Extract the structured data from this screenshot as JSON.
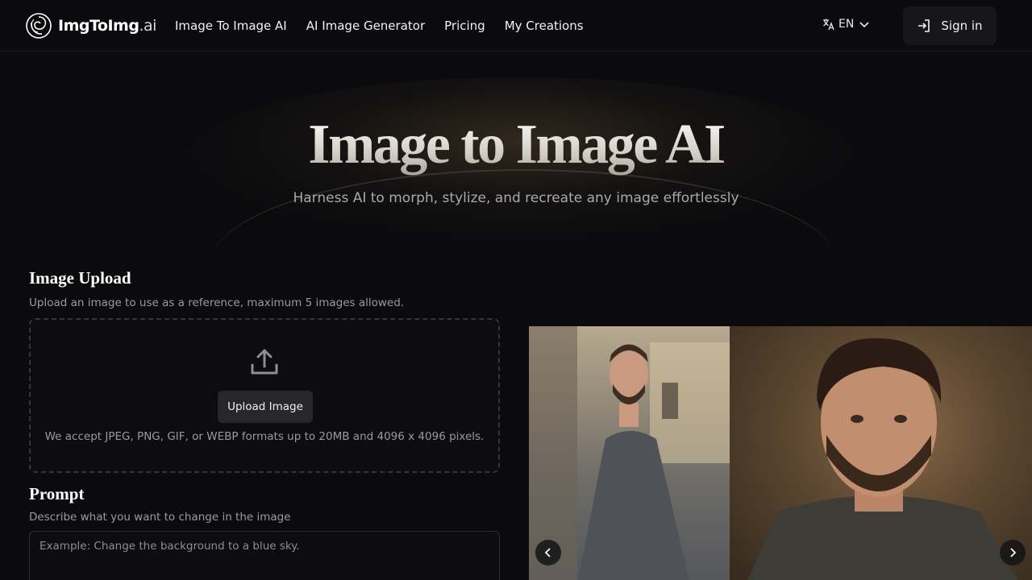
{
  "header": {
    "logo_text": "ImgToImg",
    "logo_suffix": ".ai",
    "nav": [
      {
        "label": "Image To Image AI"
      },
      {
        "label": "AI Image Generator"
      },
      {
        "label": "Pricing"
      },
      {
        "label": "My Creations"
      }
    ],
    "language": "EN",
    "signin_label": "Sign in"
  },
  "hero": {
    "title": "Image to Image AI",
    "subtitle": "Harness AI to morph, stylize, and recreate any image effortlessly"
  },
  "upload": {
    "title": "Image Upload",
    "description": "Upload an image to use as a reference, maximum 5 images allowed.",
    "button_label": "Upload Image",
    "note": "We accept JPEG, PNG, GIF, or WEBP formats up to 20MB and 4096 x 4096 pixels."
  },
  "prompt": {
    "title": "Prompt",
    "description": "Describe what you want to change in the image",
    "placeholder": "Example: Change the background to a blue sky."
  },
  "icons": {
    "logo": "spiral-logo-icon",
    "language": "translate-icon",
    "chevron": "chevron-down-icon",
    "signin": "login-icon",
    "upload": "upload-icon",
    "prev": "chevron-left-icon",
    "next": "chevron-right-icon"
  }
}
